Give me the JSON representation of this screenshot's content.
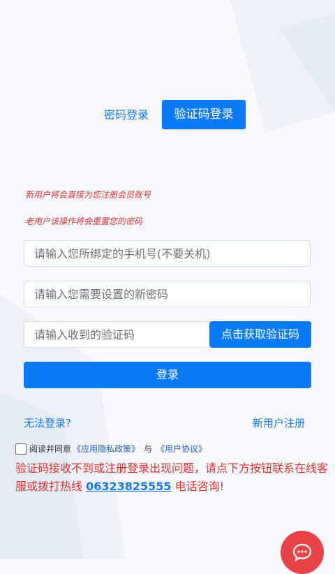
{
  "tabs": {
    "password_login": "密码登录",
    "sms_login": "验证码登录"
  },
  "notices": {
    "new_user": "新用户将会直接为您注册会员账号",
    "old_user": "老用户该操作将会重置您的密码"
  },
  "form": {
    "phone_placeholder": "请输入您所绑定的手机号(不要关机)",
    "password_placeholder": "请输入您需要设置的新密码",
    "code_placeholder": "请输入收到的验证码",
    "get_code_label": "点击获取验证码",
    "login_label": "登录"
  },
  "links": {
    "cannot_login": "无法登录?",
    "register": "新用户注册"
  },
  "agreement": {
    "prefix": "阅读并同意",
    "privacy": "《应用隐私政策》",
    "conjunction": "与",
    "user_agreement": "《用户协议》"
  },
  "warning": {
    "text_before": "验证码接收不到或注册登录出现问题，请点下方按钮联系在线客服或拨打热线 ",
    "phone": "06323825555",
    "text_after": " 电话咨询!"
  },
  "icons": {
    "chat": "chat-bubble-icon"
  },
  "colors": {
    "primary": "#0b7bf5",
    "link": "#1677e6",
    "warning": "#e0302c",
    "chat": "#e9434a"
  }
}
